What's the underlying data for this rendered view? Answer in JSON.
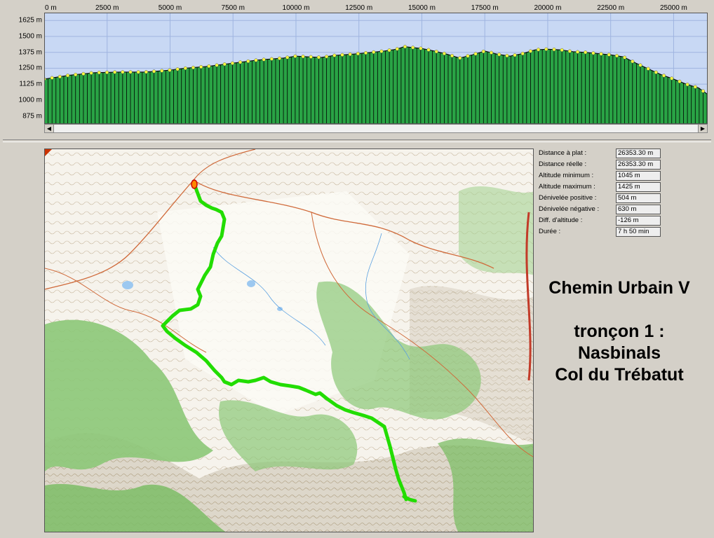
{
  "profile": {
    "x_tick_labels": [
      "0 m",
      "2500 m",
      "5000 m",
      "7500 m",
      "10000 m",
      "12500 m",
      "15000 m",
      "17500 m",
      "20000 m",
      "22500 m",
      "25000 m"
    ],
    "y_tick_labels": [
      "1625 m",
      "1500 m",
      "1375 m",
      "1250 m",
      "1125 m",
      "1000 m",
      "875 m"
    ],
    "colors": {
      "sky": "#c8d8f4",
      "fill": "#29a345",
      "grid": "#9fb4e0",
      "point": "#ffff40"
    }
  },
  "chart_data": {
    "type": "area",
    "x_unit": "m",
    "y_unit": "m",
    "xlim": [
      0,
      26353
    ],
    "ylim": [
      812,
      1687
    ],
    "x": [
      0,
      1000,
      2000,
      3000,
      4000,
      5000,
      5600,
      6500,
      7500,
      8500,
      9500,
      10000,
      10500,
      11000,
      11500,
      12500,
      13000,
      13500,
      14000,
      14300,
      15000,
      15500,
      16000,
      16500,
      17000,
      17500,
      18000,
      18500,
      19000,
      19500,
      20000,
      20500,
      21000,
      21500,
      22000,
      22500,
      23000,
      23500,
      24000,
      24500,
      25000,
      25500,
      26000,
      26353
    ],
    "y": [
      1165,
      1195,
      1215,
      1220,
      1220,
      1235,
      1250,
      1265,
      1290,
      1315,
      1330,
      1345,
      1340,
      1335,
      1350,
      1365,
      1375,
      1385,
      1400,
      1420,
      1405,
      1385,
      1360,
      1330,
      1355,
      1385,
      1360,
      1345,
      1365,
      1395,
      1400,
      1395,
      1380,
      1375,
      1365,
      1355,
      1340,
      1290,
      1245,
      1200,
      1165,
      1125,
      1095,
      1045
    ]
  },
  "map": {
    "colors": {
      "route": "#22dd00",
      "forest": "#8cc878",
      "paper": "#f6f3ec",
      "road": "#d06a3a"
    }
  },
  "stats": [
    {
      "label": "Distance à plat :",
      "value": "26353.30 m"
    },
    {
      "label": "Distance réelle :",
      "value": "26353.30 m"
    },
    {
      "label": "Altitude minimum :",
      "value": "1045 m"
    },
    {
      "label": "Altitude maximum :",
      "value": "1425 m"
    },
    {
      "label": "Dénivelée positive :",
      "value": "504 m"
    },
    {
      "label": "Dénivelée négative :",
      "value": "630 m"
    },
    {
      "label": "Diff. d'altitude :",
      "value": "-126 m"
    },
    {
      "label": "Durée :",
      "value": "7 h 50 min"
    }
  ],
  "title": {
    "line1": "Chemin Urbain V",
    "line2": "tronçon 1 :",
    "line3": "Nasbinals",
    "line4": "Col du Trébatut"
  }
}
